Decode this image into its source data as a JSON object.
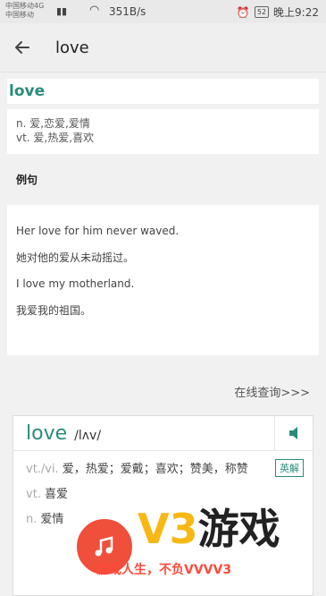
{
  "status": {
    "carrier1": "中国移动4G",
    "carrier2": "中国移动",
    "network": "4G",
    "speed": "351B/s",
    "battery": "52",
    "time": "晚上9:22"
  },
  "appbar": {
    "title": "love"
  },
  "word": "love",
  "definitions": [
    "n. 爱,恋爱,爱情",
    "vt. 爱,热爱,喜欢"
  ],
  "examples_title": "例句",
  "examples": [
    "Her love for him never waved.",
    "她对他的爱从未动摇过。",
    "I love my motherland.",
    "我爱我的祖国。"
  ],
  "online_query": "在线查询>>>",
  "dict": {
    "word": "love",
    "phonetic": "/lʌv/",
    "tag": "英解",
    "rows": [
      {
        "pos": "vt./vi.",
        "text": "爱，热爱；爱戴；喜欢；赞美，称赞"
      },
      {
        "pos": "vt.",
        "text": "喜爱"
      },
      {
        "pos": "n.",
        "text": "爱情"
      }
    ]
  },
  "watermark": {
    "logo": "V3游戏",
    "slogan": "游戏人生，不负VVVV3"
  }
}
